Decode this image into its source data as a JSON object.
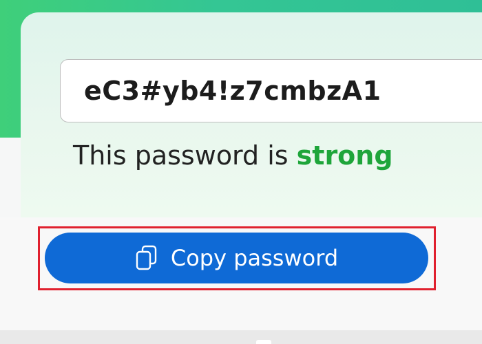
{
  "password": {
    "value": "eC3#yb4!z7cmbzA1"
  },
  "strength": {
    "prefix": "This password is ",
    "level": "strong",
    "level_color": "#1ea53a"
  },
  "copy_button": {
    "label": "Copy password",
    "icon": "copy-icon",
    "color": "#0f6ad6"
  },
  "highlight": {
    "color": "#e0202e"
  },
  "theme": {
    "accent_gradient_start": "#3fcf7a",
    "accent_gradient_end": "#2fbf96"
  }
}
